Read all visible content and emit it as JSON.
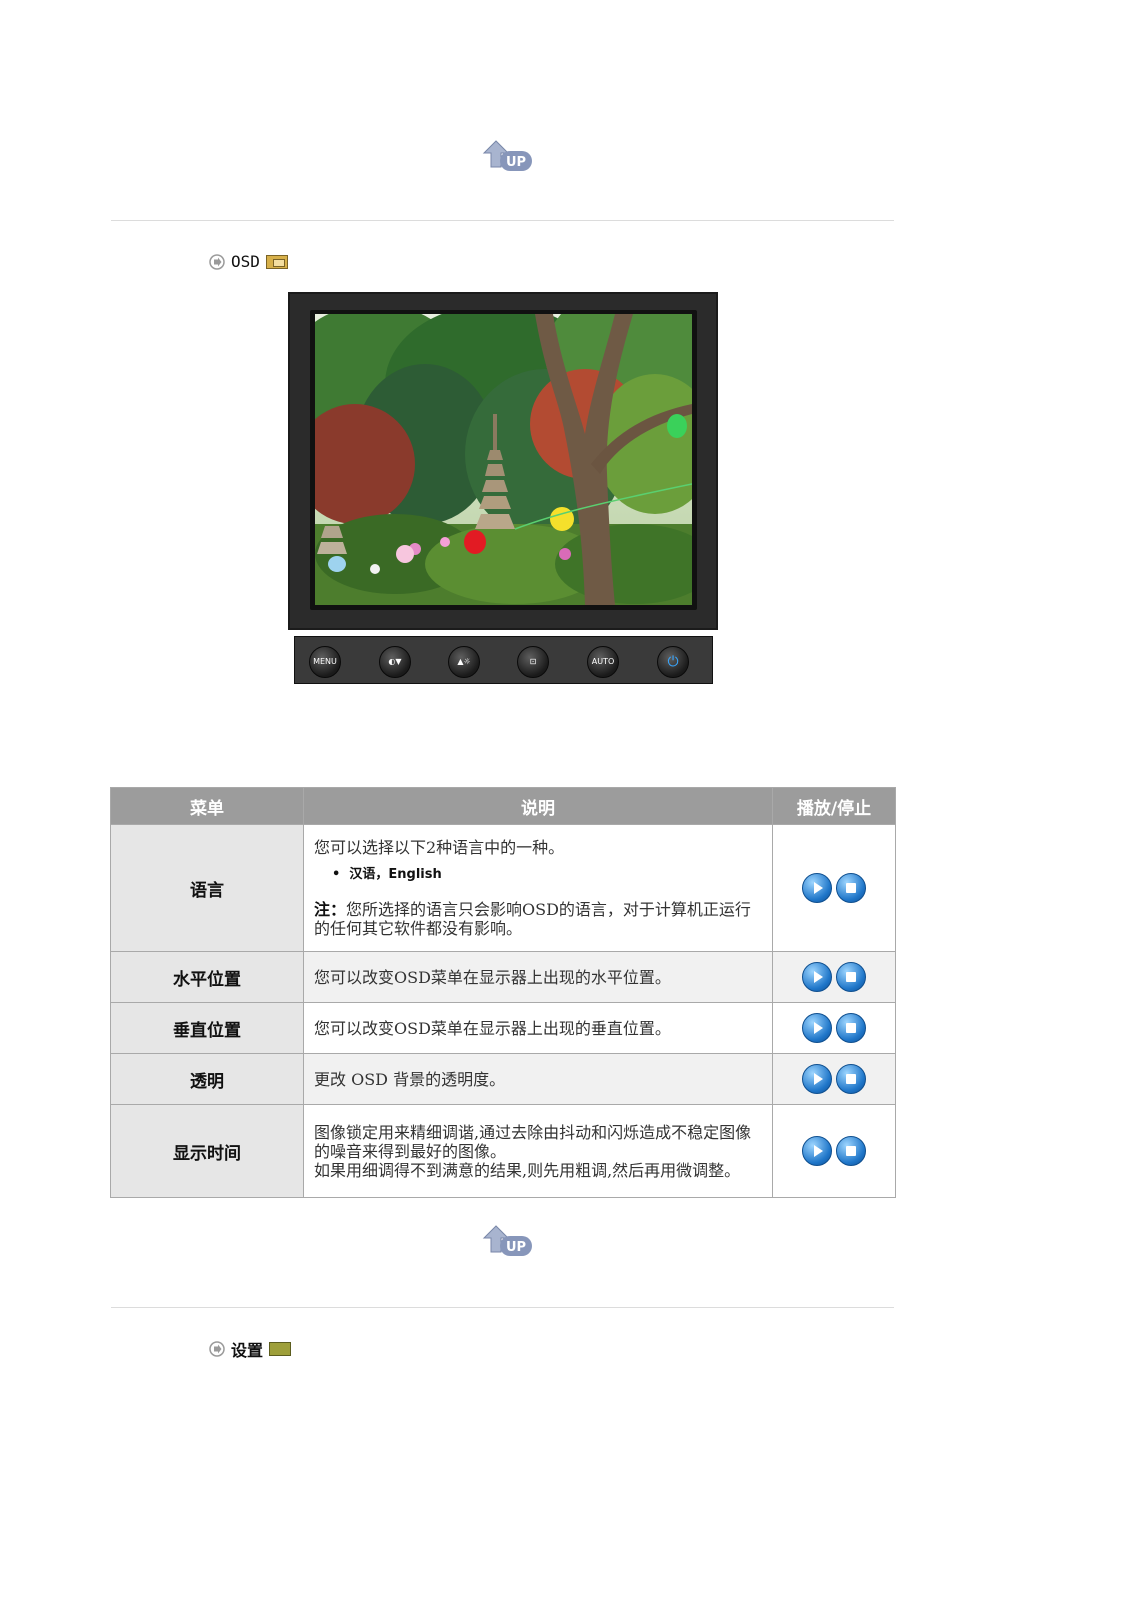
{
  "nav": {
    "up_label": "UP"
  },
  "section_osd": {
    "title": "OSD"
  },
  "section_setup": {
    "title": "设置"
  },
  "control_buttons": [
    {
      "label": "MENU",
      "icon": "menu-icon"
    },
    {
      "label": "",
      "icon": "magic-bright-down-icon"
    },
    {
      "label": "",
      "icon": "brightness-up-icon"
    },
    {
      "label": "",
      "icon": "source-enter-icon"
    },
    {
      "label": "AUTO",
      "icon": "auto-icon"
    },
    {
      "label": "",
      "icon": "power-icon"
    }
  ],
  "table": {
    "headers": {
      "menu": "菜单",
      "desc": "说明",
      "play": "播放/停止"
    },
    "rows": [
      {
        "menu": "语言",
        "desc": "您可以选择以下2种语言中的一种。",
        "bullet": "汉语，English",
        "note_label": "注：",
        "note": "您所选择的语言只会影响OSD的语言，对于计算机正运行的任何其它软件都没有影响。"
      },
      {
        "menu": "水平位置",
        "desc": "您可以改变OSD菜单在显示器上出现的水平位置。"
      },
      {
        "menu": "垂直位置",
        "desc": "您可以改变OSD菜单在显示器上出现的垂直位置。"
      },
      {
        "menu": "透明",
        "desc": "更改 OSD 背景的透明度。"
      },
      {
        "menu": "显示时间",
        "desc": "图像锁定用来精细调谐,通过去除由抖动和闪烁造成不稳定图像的噪音来得到最好的图像。",
        "desc2": "如果用细调得不到满意的结果,则先用粗调,然后再用微调整。"
      }
    ]
  }
}
